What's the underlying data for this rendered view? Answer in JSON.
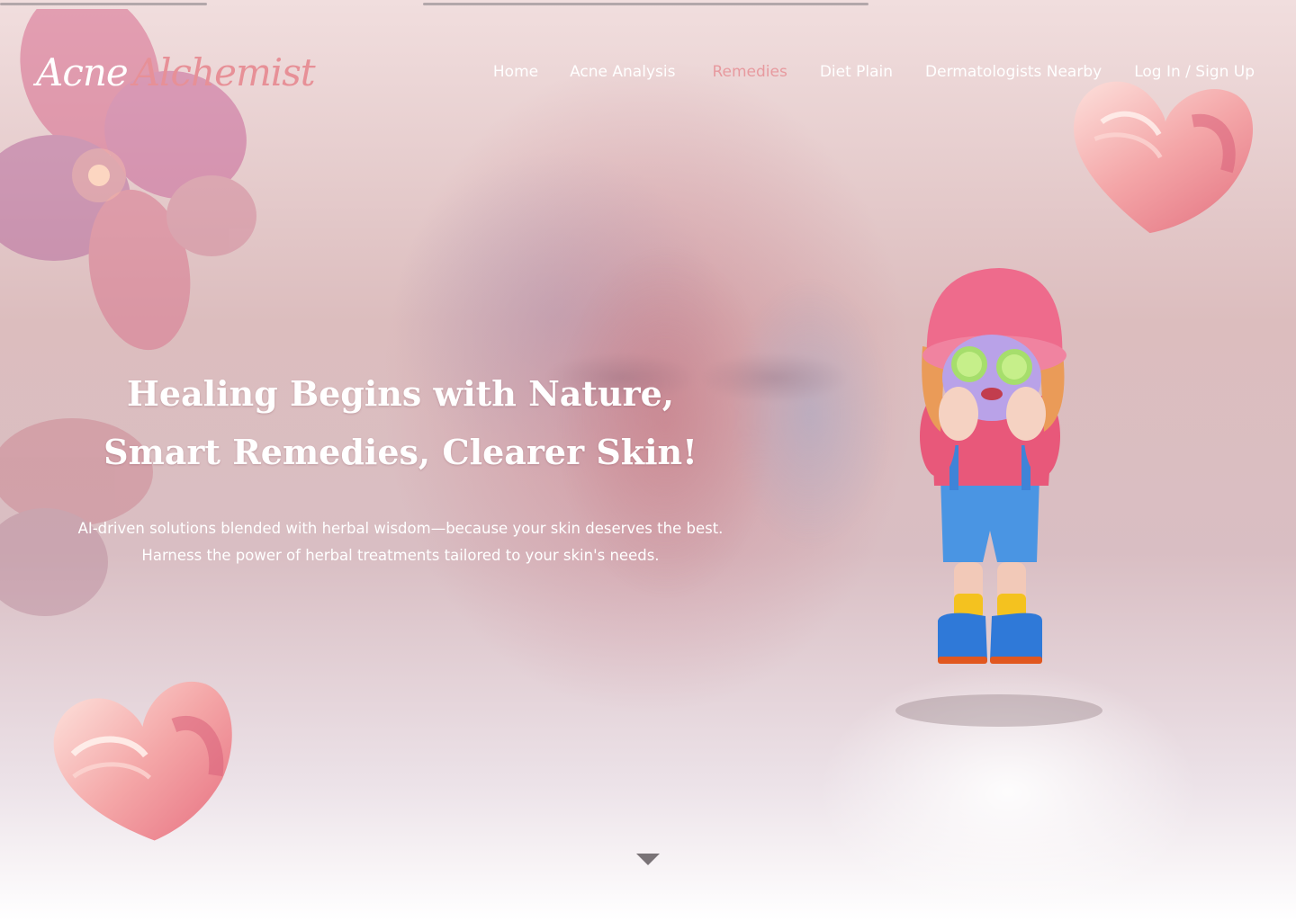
{
  "logo": {
    "word1": "Acne",
    "word2": "Alchemist"
  },
  "nav": {
    "home": "Home",
    "acne_analysis": "Acne Analysis",
    "remedies": "Remedies",
    "diet_plan": "Diet Plain",
    "dermatologists": "Dermatologists Nearby",
    "login": "Log In / Sign Up"
  },
  "hero": {
    "title_line1": "Healing Begins with Nature,",
    "title_line2": "Smart Remedies, Clearer Skin!",
    "sub_line1": "AI-driven solutions blended with herbal wisdom—because your skin deserves the best.",
    "sub_line2": "Harness the power of herbal treatments tailored to your skin's needs."
  },
  "colors": {
    "accent": "#e79a9f",
    "text": "#ffffff"
  },
  "icons": {
    "scroll": "triangle-down-icon"
  }
}
